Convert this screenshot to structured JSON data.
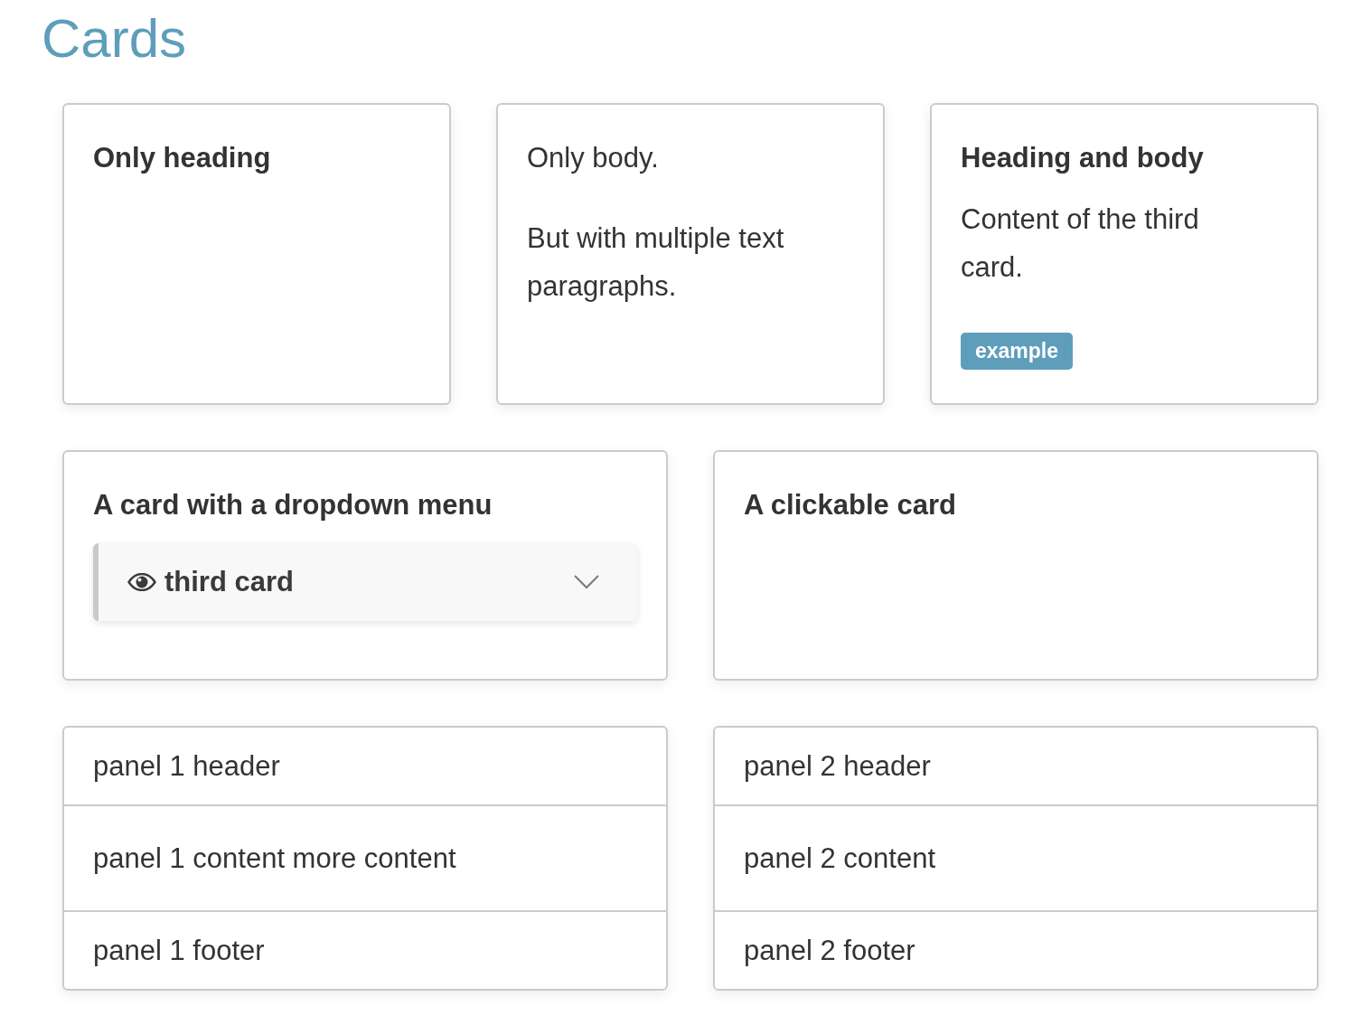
{
  "page": {
    "title": "Cards"
  },
  "card_rows": [
    {
      "cards": [
        {
          "kind": "text",
          "heading": "Only heading"
        },
        {
          "kind": "text",
          "paragraphs": [
            "Only body.",
            "But with multiple text paragraphs."
          ]
        },
        {
          "kind": "text",
          "heading": "Heading and body",
          "paragraphs": [
            "Content of the third card."
          ],
          "badge": "example"
        }
      ]
    },
    {
      "cards": [
        {
          "kind": "dropdown",
          "heading": "A card with a dropdown menu",
          "dropdown": {
            "value": "third card"
          }
        },
        {
          "kind": "text",
          "heading": "A clickable card"
        }
      ]
    }
  ],
  "panels": [
    {
      "header": "panel 1 header",
      "content": "panel 1 content more content",
      "footer": "panel 1 footer"
    },
    {
      "header": "panel 2 header",
      "content": "panel 2 content",
      "footer": "panel 2 footer"
    }
  ]
}
